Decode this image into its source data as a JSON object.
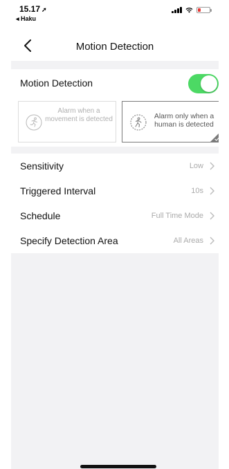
{
  "status_bar": {
    "time": "15.17",
    "location_arrow": "➚",
    "back_app": "◂ Haku"
  },
  "nav": {
    "title": "Motion Detection",
    "back_icon": "chevron-left-icon"
  },
  "motion_detection": {
    "label": "Motion Detection",
    "enabled": true,
    "toggle_color": "#4cd964",
    "modes": [
      {
        "label": "Alarm when a movement is detected",
        "selected": false,
        "icon": "running-person-icon"
      },
      {
        "label": "Alarm only when a human is detected",
        "selected": true,
        "icon": "human-detect-icon"
      }
    ]
  },
  "settings": [
    {
      "label": "Sensitivity",
      "value": "Low"
    },
    {
      "label": "Triggered Interval",
      "value": "10s"
    },
    {
      "label": "Schedule",
      "value": "Full Time Mode"
    },
    {
      "label": "Specify Detection Area",
      "value": "All Areas"
    }
  ],
  "colors": {
    "background": "#f2f2f4",
    "battery_low": "#e53935"
  }
}
